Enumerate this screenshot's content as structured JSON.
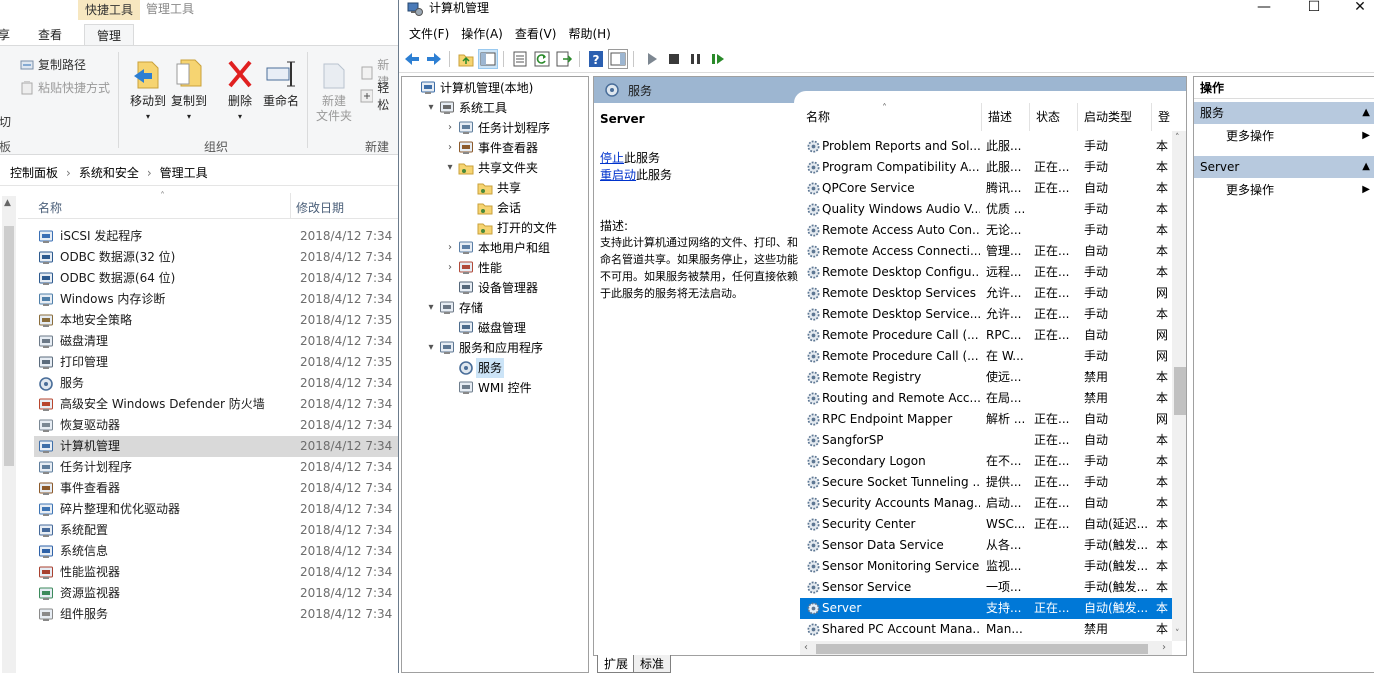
{
  "explorer": {
    "ribbon": {
      "context_group": "快捷工具",
      "context_group2": "管理工具",
      "tabs": [
        "享",
        "查看",
        "管理"
      ],
      "copy_path": "复制路径",
      "paste_shortcut": "粘贴快捷方式",
      "cut_fragment": "切",
      "board_fragment": "板",
      "move_to": "移动到",
      "copy_to": "复制到",
      "delete": "删除",
      "rename": "重命名",
      "new_item": "新建",
      "new_folder_line1": "新建",
      "new_folder_line2": "文件夹",
      "easy_access": "轻松",
      "group_organize": "组织",
      "group_new": "新建"
    },
    "breadcrumb": [
      "控制面板",
      "系统和安全",
      "管理工具"
    ],
    "columns": {
      "name": "名称",
      "date": "修改日期"
    },
    "items": [
      {
        "name": "iSCSI 发起程序",
        "date": "2018/4/12 7:34",
        "icon": "iscsi-icon"
      },
      {
        "name": "ODBC 数据源(32 位)",
        "date": "2018/4/12 7:34",
        "icon": "odbc-icon"
      },
      {
        "name": "ODBC 数据源(64 位)",
        "date": "2018/4/12 7:34",
        "icon": "odbc-icon"
      },
      {
        "name": "Windows 内存诊断",
        "date": "2018/4/12 7:34",
        "icon": "memory-icon"
      },
      {
        "name": "本地安全策略",
        "date": "2018/4/12 7:35",
        "icon": "policy-icon"
      },
      {
        "name": "磁盘清理",
        "date": "2018/4/12 7:34",
        "icon": "disk-cleanup-icon"
      },
      {
        "name": "打印管理",
        "date": "2018/4/12 7:35",
        "icon": "printer-icon"
      },
      {
        "name": "服务",
        "date": "2018/4/12 7:34",
        "icon": "services-icon"
      },
      {
        "name": "高级安全 Windows Defender 防火墙",
        "date": "2018/4/12 7:34",
        "icon": "firewall-icon"
      },
      {
        "name": "恢复驱动器",
        "date": "2018/4/12 7:34",
        "icon": "recovery-icon"
      },
      {
        "name": "计算机管理",
        "date": "2018/4/12 7:34",
        "icon": "computer-mgmt-icon"
      },
      {
        "name": "任务计划程序",
        "date": "2018/4/12 7:34",
        "icon": "task-scheduler-icon"
      },
      {
        "name": "事件查看器",
        "date": "2018/4/12 7:34",
        "icon": "event-viewer-icon"
      },
      {
        "name": "碎片整理和优化驱动器",
        "date": "2018/4/12 7:34",
        "icon": "defrag-icon"
      },
      {
        "name": "系统配置",
        "date": "2018/4/12 7:34",
        "icon": "sysconfig-icon"
      },
      {
        "name": "系统信息",
        "date": "2018/4/12 7:34",
        "icon": "sysinfo-icon"
      },
      {
        "name": "性能监视器",
        "date": "2018/4/12 7:34",
        "icon": "perfmon-icon"
      },
      {
        "name": "资源监视器",
        "date": "2018/4/12 7:34",
        "icon": "resmon-icon"
      },
      {
        "name": "组件服务",
        "date": "2018/4/12 7:34",
        "icon": "component-services-icon"
      }
    ],
    "selected_index": 10
  },
  "mmc": {
    "title": "计算机管理",
    "window_controls": {
      "minimize": "—",
      "maximize": "☐",
      "close": "✕"
    },
    "menu": [
      "文件(F)",
      "操作(A)",
      "查看(V)",
      "帮助(H)"
    ],
    "tree": [
      {
        "label": "计算机管理(本地)",
        "level": 0,
        "toggle": "",
        "icon": "computer-mgmt-icon"
      },
      {
        "label": "系统工具",
        "level": 1,
        "toggle": "▾",
        "icon": "tools-icon"
      },
      {
        "label": "任务计划程序",
        "level": 2,
        "toggle": "›",
        "icon": "task-scheduler-icon"
      },
      {
        "label": "事件查看器",
        "level": 2,
        "toggle": "›",
        "icon": "event-viewer-icon"
      },
      {
        "label": "共享文件夹",
        "level": 2,
        "toggle": "▾",
        "icon": "shared-folder-icon"
      },
      {
        "label": "共享",
        "level": 3,
        "toggle": "",
        "icon": "shared-folder-icon"
      },
      {
        "label": "会话",
        "level": 3,
        "toggle": "",
        "icon": "shared-folder-icon"
      },
      {
        "label": "打开的文件",
        "level": 3,
        "toggle": "",
        "icon": "shared-folder-icon"
      },
      {
        "label": "本地用户和组",
        "level": 2,
        "toggle": "›",
        "icon": "users-icon"
      },
      {
        "label": "性能",
        "level": 2,
        "toggle": "›",
        "icon": "performance-icon"
      },
      {
        "label": "设备管理器",
        "level": 2,
        "toggle": "",
        "icon": "device-manager-icon"
      },
      {
        "label": "存储",
        "level": 1,
        "toggle": "▾",
        "icon": "storage-icon"
      },
      {
        "label": "磁盘管理",
        "level": 2,
        "toggle": "",
        "icon": "disk-icon"
      },
      {
        "label": "服务和应用程序",
        "level": 1,
        "toggle": "▾",
        "icon": "services-apps-icon"
      },
      {
        "label": "服务",
        "level": 2,
        "toggle": "",
        "icon": "services-icon"
      },
      {
        "label": "WMI 控件",
        "level": 2,
        "toggle": "",
        "icon": "wmi-icon"
      }
    ],
    "tree_selected_index": 14,
    "center": {
      "header": "服务",
      "extended": {
        "service_name": "Server",
        "stop_link": "停止",
        "stop_suffix": "此服务",
        "restart_link": "重启动",
        "restart_suffix": "此服务",
        "desc_label": "描述:",
        "desc_text": "支持此计算机通过网络的文件、打印、和命名管道共享。如果服务停止，这些功能不可用。如果服务被禁用，任何直接依赖于此服务的服务将无法启动。"
      },
      "columns": [
        "名称",
        "描述",
        "状态",
        "启动类型",
        "登"
      ],
      "services": [
        {
          "name": "Problem Reports and Sol...",
          "desc": "此服...",
          "status": "",
          "startup": "手动",
          "logon": "本"
        },
        {
          "name": "Program Compatibility A...",
          "desc": "此服...",
          "status": "正在...",
          "startup": "手动",
          "logon": "本"
        },
        {
          "name": "QPCore Service",
          "desc": "腾讯...",
          "status": "正在...",
          "startup": "自动",
          "logon": "本"
        },
        {
          "name": "Quality Windows Audio V...",
          "desc": "优质 ...",
          "status": "",
          "startup": "手动",
          "logon": "本"
        },
        {
          "name": "Remote Access Auto Con...",
          "desc": "无论...",
          "status": "",
          "startup": "手动",
          "logon": "本"
        },
        {
          "name": "Remote Access Connecti...",
          "desc": "管理...",
          "status": "正在...",
          "startup": "自动",
          "logon": "本"
        },
        {
          "name": "Remote Desktop Configu...",
          "desc": "远程...",
          "status": "正在...",
          "startup": "手动",
          "logon": "本"
        },
        {
          "name": "Remote Desktop Services",
          "desc": "允许...",
          "status": "正在...",
          "startup": "手动",
          "logon": "网"
        },
        {
          "name": "Remote Desktop Service...",
          "desc": "允许...",
          "status": "正在...",
          "startup": "手动",
          "logon": "本"
        },
        {
          "name": "Remote Procedure Call (...",
          "desc": "RPC...",
          "status": "正在...",
          "startup": "自动",
          "logon": "网"
        },
        {
          "name": "Remote Procedure Call (...",
          "desc": "在 W...",
          "status": "",
          "startup": "手动",
          "logon": "网"
        },
        {
          "name": "Remote Registry",
          "desc": "使远...",
          "status": "",
          "startup": "禁用",
          "logon": "本"
        },
        {
          "name": "Routing and Remote Acc...",
          "desc": "在局...",
          "status": "",
          "startup": "禁用",
          "logon": "本"
        },
        {
          "name": "RPC Endpoint Mapper",
          "desc": "解析 ...",
          "status": "正在...",
          "startup": "自动",
          "logon": "网"
        },
        {
          "name": "SangforSP",
          "desc": "",
          "status": "正在...",
          "startup": "自动",
          "logon": "本"
        },
        {
          "name": "Secondary Logon",
          "desc": "在不...",
          "status": "正在...",
          "startup": "手动",
          "logon": "本"
        },
        {
          "name": "Secure Socket Tunneling ...",
          "desc": "提供...",
          "status": "正在...",
          "startup": "手动",
          "logon": "本"
        },
        {
          "name": "Security Accounts Manag...",
          "desc": "启动...",
          "status": "正在...",
          "startup": "自动",
          "logon": "本"
        },
        {
          "name": "Security Center",
          "desc": "WSC...",
          "status": "正在...",
          "startup": "自动(延迟...",
          "logon": "本"
        },
        {
          "name": "Sensor Data Service",
          "desc": "从各...",
          "status": "",
          "startup": "手动(触发...",
          "logon": "本"
        },
        {
          "name": "Sensor Monitoring Service",
          "desc": "监视...",
          "status": "",
          "startup": "手动(触发...",
          "logon": "本"
        },
        {
          "name": "Sensor Service",
          "desc": "一项...",
          "status": "",
          "startup": "手动(触发...",
          "logon": "本"
        },
        {
          "name": "Server",
          "desc": "支持...",
          "status": "正在...",
          "startup": "自动(触发...",
          "logon": "本"
        },
        {
          "name": "Shared PC Account Mana...",
          "desc": "Man...",
          "status": "",
          "startup": "禁用",
          "logon": "本"
        }
      ],
      "selected_service_index": 22
    },
    "bottom_tabs": [
      "扩展",
      "标准"
    ],
    "actions": {
      "title": "操作",
      "sections": [
        {
          "header": "服务",
          "item": "更多操作"
        },
        {
          "header": "Server",
          "item": "更多操作"
        }
      ]
    }
  }
}
